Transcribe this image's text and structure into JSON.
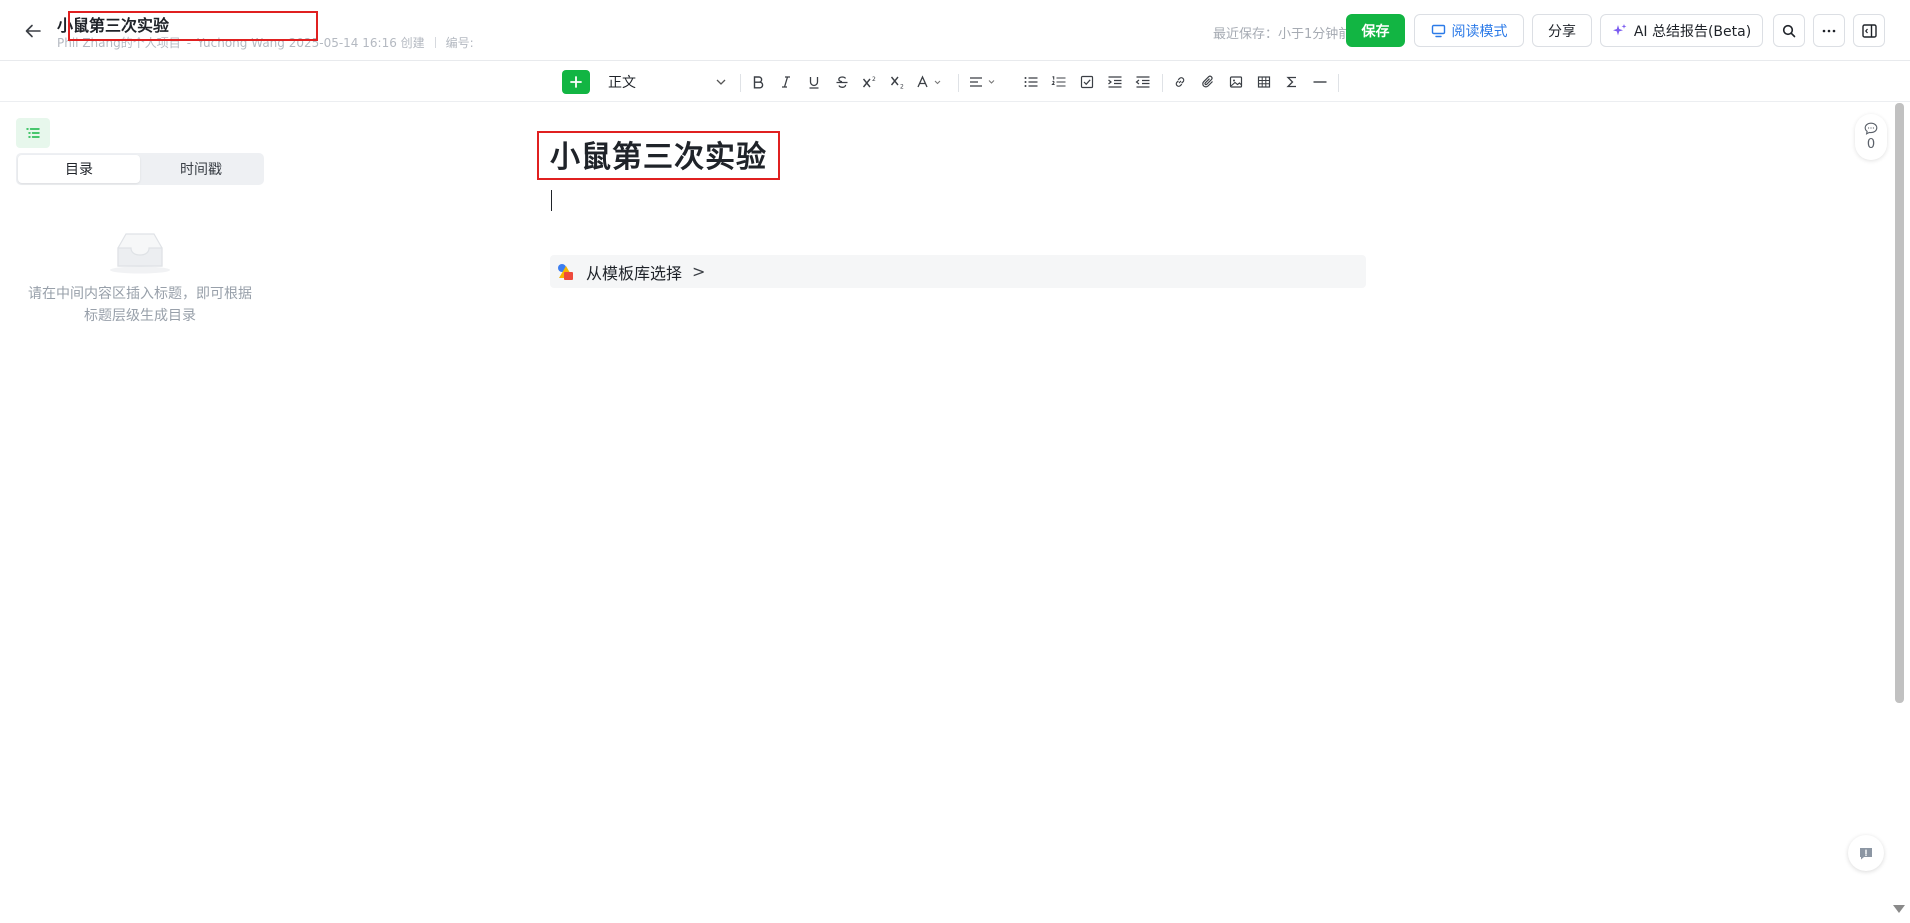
{
  "header": {
    "title": "小鼠第三次实验",
    "meta_author_project": "Phil Zhang的个人项目",
    "meta_creator": "Yuchong Wang 2025-05-14 16:16 创建",
    "meta_number_label": "编号:",
    "save_status": "最近保存：小于1分钟前",
    "save_button": "保存",
    "read_mode_button": "阅读模式",
    "share_button": "分享",
    "ai_summary_button": "AI 总结报告(Beta)"
  },
  "toolbar": {
    "paragraph_style": "正文"
  },
  "left_panel": {
    "tabs": [
      "目录",
      "时间戳"
    ],
    "empty_text": "请在中间内容区插入标题，即可根据标题层级生成目录"
  },
  "editor": {
    "title": "小鼠第三次实验",
    "template_label": "从模板库选择",
    "template_arrow": ">"
  },
  "comments": {
    "count": "0"
  },
  "colors": {
    "accent_green": "#12b543",
    "highlight_red": "#e02020",
    "link_blue": "#2b7ae8"
  }
}
